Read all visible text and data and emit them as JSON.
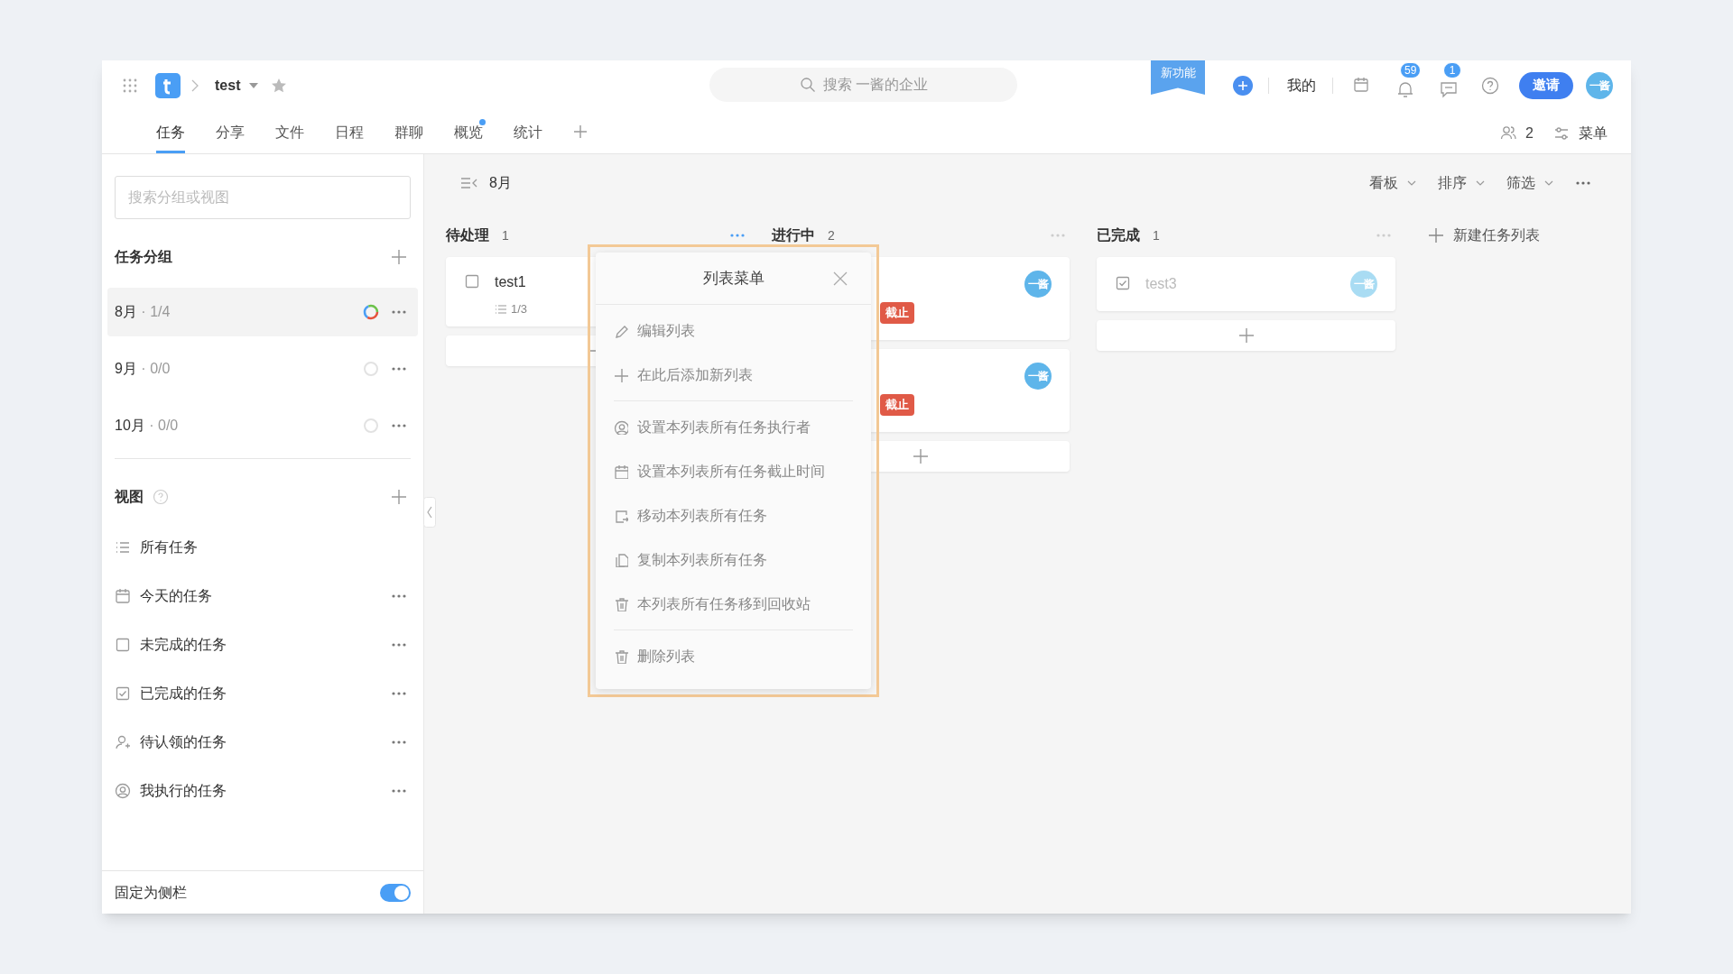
{
  "header": {
    "project": "test",
    "starred": false,
    "search_placeholder": "搜索 一酱的企业",
    "new_feature": "新功能",
    "mine": "我的",
    "notifications": "59",
    "messages": "1",
    "invite": "邀请",
    "avatar": "一酱"
  },
  "tabs": [
    {
      "label": "任务",
      "selected": true,
      "dot": false
    },
    {
      "label": "分享",
      "selected": false,
      "dot": false
    },
    {
      "label": "文件",
      "selected": false,
      "dot": false
    },
    {
      "label": "日程",
      "selected": false,
      "dot": false
    },
    {
      "label": "群聊",
      "selected": false,
      "dot": false
    },
    {
      "label": "概览",
      "selected": false,
      "dot": true
    },
    {
      "label": "统计",
      "selected": false,
      "dot": false
    }
  ],
  "members": "2",
  "menu": "菜单",
  "sidebar": {
    "search_placeholder": "搜索分组或视图",
    "groups_title": "任务分组",
    "groups": [
      {
        "name": "8月",
        "count": " · 1/4",
        "selected": true,
        "kind": "progress"
      },
      {
        "name": "9月",
        "count": " · 0/0",
        "selected": false,
        "kind": "empty"
      },
      {
        "name": "10月",
        "count": " · 0/0",
        "selected": false,
        "kind": "empty"
      }
    ],
    "views_title": "视图",
    "views": [
      {
        "label": "所有任务",
        "kind": "list",
        "has_menu": false
      },
      {
        "label": "今天的任务",
        "kind": "calendar",
        "has_menu": true
      },
      {
        "label": "未完成的任务",
        "kind": "box",
        "has_menu": true
      },
      {
        "label": "已完成的任务",
        "kind": "checked",
        "has_menu": true
      },
      {
        "label": "待认领的任务",
        "kind": "claim",
        "has_menu": true
      },
      {
        "label": "我执行的任务",
        "kind": "person",
        "has_menu": true
      }
    ],
    "pin": {
      "label": "固定为侧栏",
      "on": true
    }
  },
  "board": {
    "title": "8月",
    "view": "看板",
    "sort": "排序",
    "filter": "筛选",
    "new_list": "新建任务列表",
    "columns": [
      {
        "name": "待处理",
        "count": "1",
        "menu_active": true,
        "cards": [
          {
            "title": "test1",
            "checked": false,
            "subtasks": "1/3"
          }
        ]
      },
      {
        "name": "进行中",
        "count": "2",
        "menu_active": false,
        "cards": [
          {
            "badge": "截止",
            "avatar": "一酱"
          },
          {
            "badge": "截止",
            "avatar": "一酱"
          }
        ]
      },
      {
        "name": "已完成",
        "count": "1",
        "menu_active": false,
        "cards": [
          {
            "title": "test3",
            "checked": true,
            "avatar": "一酱"
          }
        ]
      }
    ]
  },
  "list_menu": {
    "title": "列表菜单",
    "sections": [
      [
        {
          "label": "编辑列表",
          "kind": "pencil"
        },
        {
          "label": "在此后添加新列表",
          "kind": "plus"
        }
      ],
      [
        {
          "label": "设置本列表所有任务执行者",
          "kind": "person"
        },
        {
          "label": "设置本列表所有任务截止时间",
          "kind": "calendar"
        },
        {
          "label": "移动本列表所有任务",
          "kind": "move"
        },
        {
          "label": "复制本列表所有任务",
          "kind": "copy"
        },
        {
          "label": "本列表所有任务移到回收站",
          "kind": "trash"
        }
      ],
      [
        {
          "label": "删除列表",
          "kind": "trash"
        }
      ]
    ]
  }
}
